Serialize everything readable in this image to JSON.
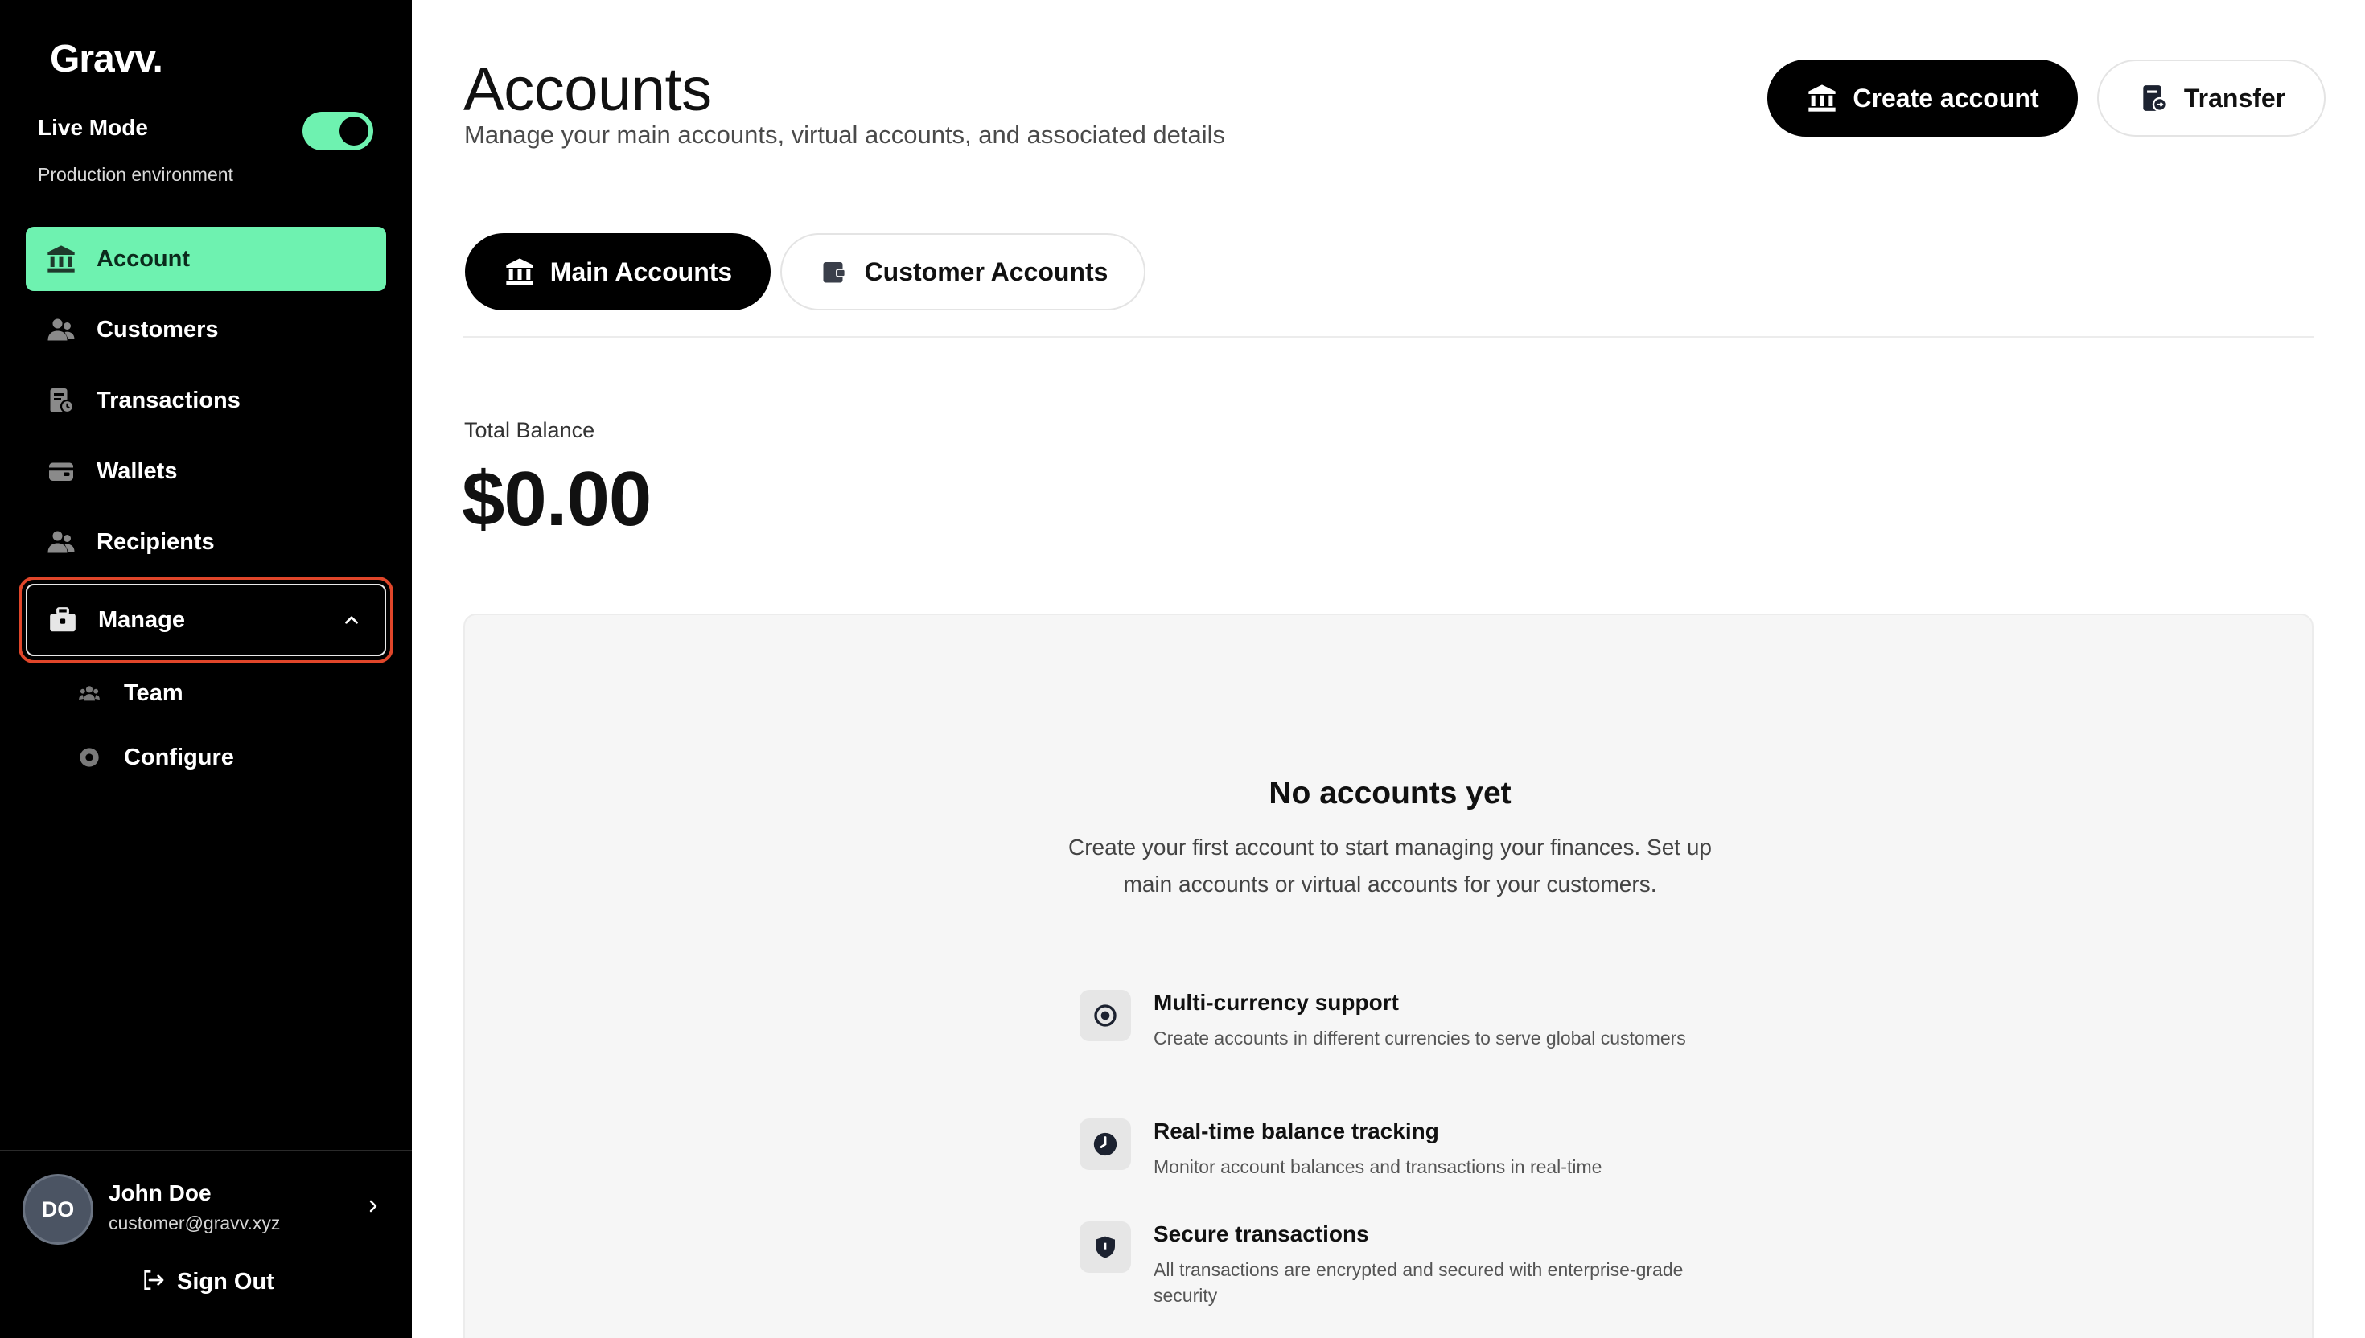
{
  "sidebar": {
    "logo": "Gravv.",
    "mode": {
      "label": "Live Mode",
      "environment": "Production environment",
      "enabled": true
    },
    "nav": [
      {
        "label": "Account",
        "icon": "bank-icon",
        "active": true
      },
      {
        "label": "Customers",
        "icon": "users-icon",
        "active": false
      },
      {
        "label": "Transactions",
        "icon": "receipt-clock-icon",
        "active": false
      },
      {
        "label": "Wallets",
        "icon": "wallet-icon",
        "active": false
      },
      {
        "label": "Recipients",
        "icon": "users-icon",
        "active": false
      }
    ],
    "manage": {
      "label": "Manage",
      "icon": "briefcase-icon",
      "expanded": true,
      "children": [
        {
          "label": "Team",
          "icon": "team-icon"
        },
        {
          "label": "Configure",
          "icon": "settings-circle-icon"
        }
      ]
    },
    "user": {
      "initials": "DO",
      "name": "John Doe",
      "email": "customer@gravv.xyz"
    },
    "signout_label": "Sign Out"
  },
  "header": {
    "title": "Accounts",
    "subtitle": "Manage your main accounts, virtual accounts, and associated details",
    "create_label": "Create account",
    "transfer_label": "Transfer"
  },
  "tabs": [
    {
      "label": "Main Accounts",
      "active": true
    },
    {
      "label": "Customer Accounts",
      "active": false
    }
  ],
  "balance": {
    "label": "Total Balance",
    "value": "$0.00"
  },
  "empty_state": {
    "title": "No accounts yet",
    "description": "Create your first account to start managing your finances. Set up main accounts or virtual accounts for your customers.",
    "features": [
      {
        "title": "Multi-currency support",
        "description": "Create accounts in different currencies to serve global customers",
        "icon": "target-icon"
      },
      {
        "title": "Real-time balance tracking",
        "description": "Monitor account balances and transactions in real-time",
        "icon": "clock-icon"
      },
      {
        "title": "Secure transactions",
        "description": "All transactions are encrypted and secured with enterprise-grade security",
        "icon": "shield-icon"
      }
    ]
  },
  "colors": {
    "accent": "#6ef2b0",
    "sidebar_bg": "#000000",
    "highlight_ring": "#e0462a",
    "card_bg": "#f6f6f6"
  }
}
